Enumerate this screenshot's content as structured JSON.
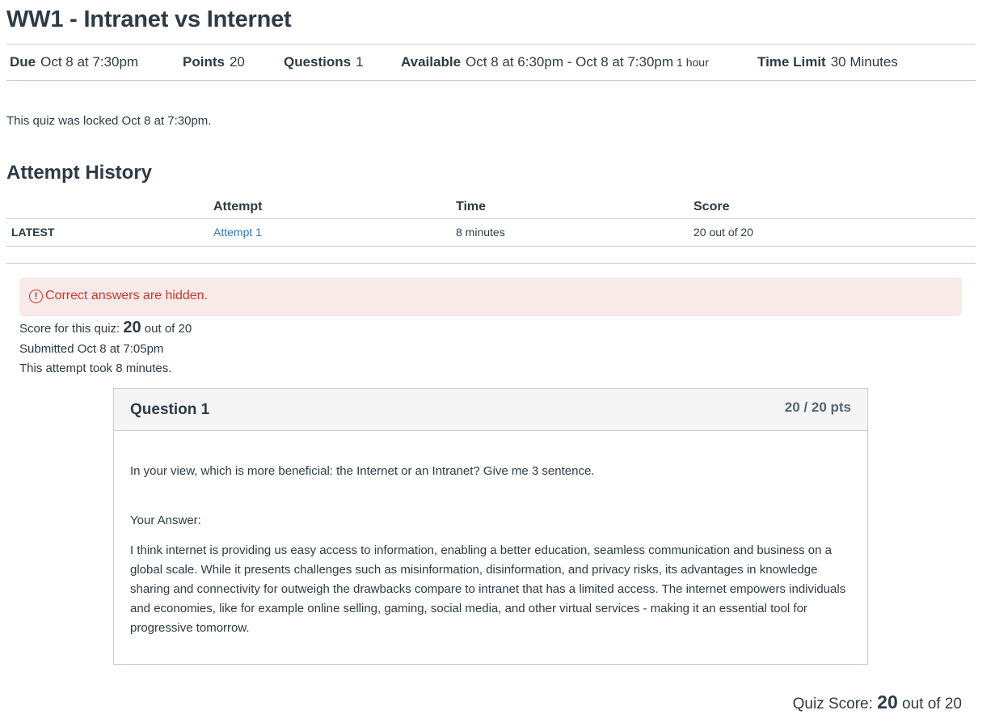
{
  "page": {
    "title": "WW1 - Intranet vs Internet"
  },
  "header": {
    "due_label": "Due",
    "due_value": "Oct 8 at 7:30pm",
    "points_label": "Points",
    "points_value": "20",
    "questions_label": "Questions",
    "questions_value": "1",
    "available_label": "Available",
    "available_value": "Oct 8 at 6:30pm - Oct 8 at 7:30pm",
    "available_duration": "1 hour",
    "time_limit_label": "Time Limit",
    "time_limit_value": "30 Minutes"
  },
  "locked_message": "This quiz was locked Oct 8 at 7:30pm.",
  "attempt_history": {
    "heading": "Attempt History",
    "columns": {
      "attempt": "Attempt",
      "time": "Time",
      "score": "Score"
    },
    "rows": [
      {
        "tag": "LATEST",
        "attempt": "Attempt 1",
        "time": "8 minutes",
        "score": "20 out of 20"
      }
    ]
  },
  "alert": {
    "icon": "warning-circle-icon",
    "text": "Correct answers are hidden.",
    "color": "#c23c2d",
    "background": "#f8eae8"
  },
  "summary": {
    "score_prefix": "Score for this quiz: ",
    "score_value": "20",
    "score_suffix": " out of 20",
    "submitted": "Submitted Oct 8 at 7:05pm",
    "took": "This attempt took 8 minutes."
  },
  "question": {
    "title": "Question 1",
    "points": "20 / 20 pts",
    "prompt": "In your view, which is more beneficial: the Internet or an Intranet? Give me 3 sentence.",
    "answer_label": "Your Answer:",
    "answer": "I think internet is providing us easy access to information, enabling a better education, seamless communication and business on a global scale. While it presents challenges such as misinformation, disinformation, and privacy risks, its advantages in knowledge sharing and connectivity for outweigh the drawbacks compare to intranet that has a limited access. The internet empowers individuals and economies, like for example online selling, gaming, social media, and other virtual services -  making it an essential tool for progressive tomorrow."
  },
  "quiz_score": {
    "prefix": "Quiz Score: ",
    "value": "20",
    "suffix": " out of 20"
  },
  "colors": {
    "text": "#2d3b45",
    "link": "#2b7abc",
    "border": "#c7cdd1",
    "header_bg": "#f5f5f5"
  }
}
